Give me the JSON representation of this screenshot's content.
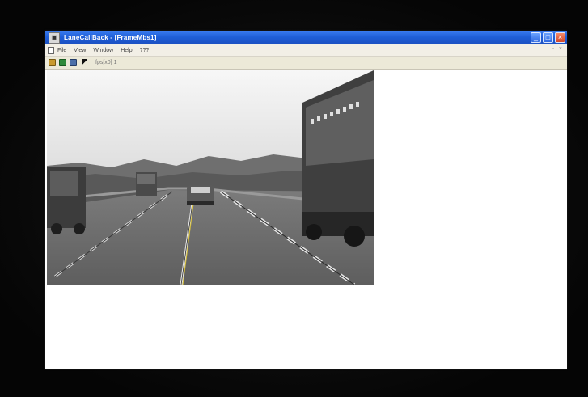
{
  "window": {
    "title": "LaneCallBack - [FrameMbs1]",
    "app_icon": "app-icon"
  },
  "title_controls": {
    "minimize_icon": "minimize-icon",
    "maximize_icon": "maximize-icon",
    "close_icon": "close-icon"
  },
  "menu": {
    "items": [
      "File",
      "View",
      "Window",
      "Help",
      "???"
    ]
  },
  "toolbar": {
    "icons": [
      "open-folder-icon",
      "save-icon",
      "video-icon",
      "cursor-icon"
    ],
    "status_text": "fps[x0] 1"
  },
  "video": {
    "scene": "highway-lane-detection"
  }
}
